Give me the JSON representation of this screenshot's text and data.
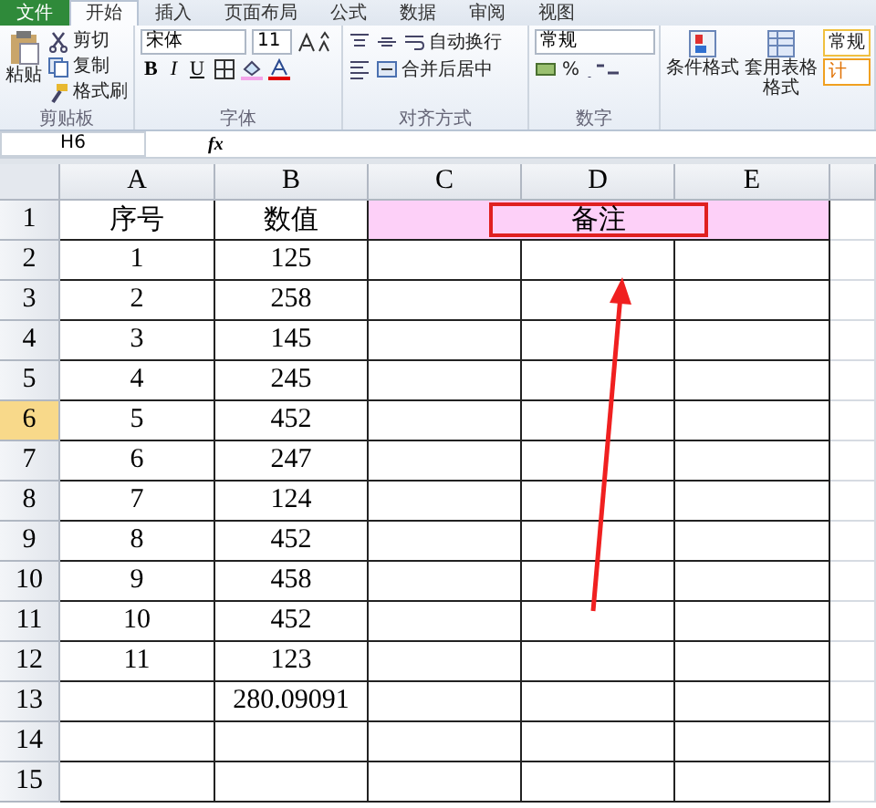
{
  "ribbon_tabs": [
    {
      "label": "文件",
      "kind": "file",
      "selected": false
    },
    {
      "label": "开始",
      "kind": "tab",
      "selected": true
    },
    {
      "label": "插入",
      "kind": "tab",
      "selected": false
    },
    {
      "label": "页面布局",
      "kind": "tab",
      "selected": false
    },
    {
      "label": "公式",
      "kind": "tab",
      "selected": false
    },
    {
      "label": "数据",
      "kind": "tab",
      "selected": false
    },
    {
      "label": "审阅",
      "kind": "tab",
      "selected": false
    },
    {
      "label": "视图",
      "kind": "tab",
      "selected": false
    }
  ],
  "clipboard": {
    "paste": "粘贴",
    "cut": "剪切",
    "copy": "复制",
    "format_painter": "格式刷",
    "label": "剪贴板"
  },
  "font": {
    "name": "宋体",
    "size": "11",
    "label": "字体",
    "bold": "B",
    "italic": "I",
    "underline": "U"
  },
  "alignment": {
    "wrap": "自动换行",
    "merge": "合并后居中",
    "label": "对齐方式"
  },
  "number": {
    "format": "常规",
    "percent": "%",
    "label": "数字"
  },
  "styles": {
    "conditional": "条件格式",
    "table": "套用表格格式",
    "style_1": "常规",
    "style_2": "计"
  },
  "formula_bar": {
    "name_box": "H6",
    "fx": "fx"
  },
  "columns": [
    "A",
    "B",
    "C",
    "D",
    "E"
  ],
  "rows": [
    {
      "header": "1",
      "selected": false,
      "a": "序号",
      "b": "数值",
      "note": {
        "text": "备注",
        "boxed": true
      }
    },
    {
      "header": "2",
      "selected": false,
      "a": "1",
      "b": "125"
    },
    {
      "header": "3",
      "selected": false,
      "a": "2",
      "b": "258"
    },
    {
      "header": "4",
      "selected": false,
      "a": "3",
      "b": "145"
    },
    {
      "header": "5",
      "selected": false,
      "a": "4",
      "b": "245"
    },
    {
      "header": "6",
      "selected": true,
      "a": "5",
      "b": "452"
    },
    {
      "header": "7",
      "selected": false,
      "a": "6",
      "b": "247"
    },
    {
      "header": "8",
      "selected": false,
      "a": "7",
      "b": "124"
    },
    {
      "header": "9",
      "selected": false,
      "a": "8",
      "b": "452"
    },
    {
      "header": "10",
      "selected": false,
      "a": "9",
      "b": "458"
    },
    {
      "header": "11",
      "selected": false,
      "a": "10",
      "b": "452"
    },
    {
      "header": "12",
      "selected": false,
      "a": "11",
      "b": "123"
    },
    {
      "header": "13",
      "selected": false,
      "b": "280.09091"
    },
    {
      "header": "14",
      "selected": false
    },
    {
      "header": "15",
      "selected": false
    }
  ],
  "pointer_arrow": true
}
